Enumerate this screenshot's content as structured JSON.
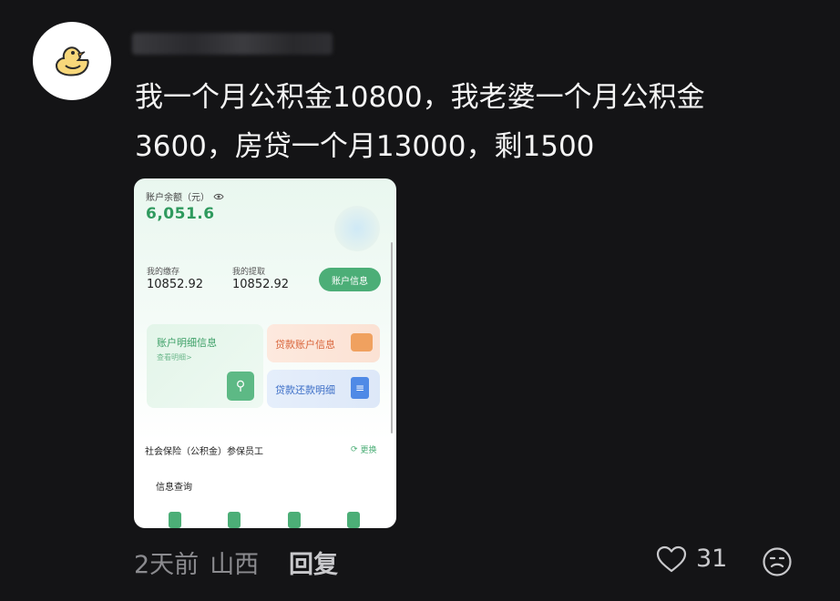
{
  "comment": {
    "avatar_icon": "duck-avatar-icon",
    "text_line1": "我一个月公积金10800，我老婆一个月公积金",
    "text_line2": "3600，房贷一个月13000，剩1500",
    "time": "2天前",
    "location": "山西",
    "reply_label": "回复",
    "like_icon": "heart-icon",
    "like_count": "31",
    "emoji_icon": "emoji-reaction-icon"
  },
  "screenshot": {
    "balance_label": "账户余额（元）",
    "balance_value": "6,051.6",
    "deposit_label": "我的缴存",
    "deposit_value": "10852.92",
    "withdraw_label": "我的提取",
    "withdraw_value": "10852.92",
    "account_info_button": "账户信息",
    "detail_title": "账户明细信息",
    "detail_sub": "查看明细>",
    "loan_account_label": "贷款账户信息",
    "loan_repay_label": "贷款还款明细",
    "insurance_text": "社会保险（公积金）参保员工",
    "switch_label": "更换",
    "query_label": "信息查询"
  }
}
